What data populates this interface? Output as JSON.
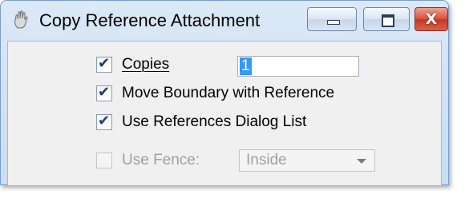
{
  "window": {
    "title": "Copy Reference Attachment",
    "icon": "hand-icon",
    "buttons": {
      "minimize": "minimize-icon",
      "maximize": "maximize-icon",
      "close": "close-icon",
      "close_glyph": "X"
    }
  },
  "form": {
    "copies": {
      "label": "Copies",
      "checked": true,
      "value": "1"
    },
    "move_boundary": {
      "label": "Move Boundary with Reference",
      "checked": true
    },
    "use_dialog_list": {
      "label": "Use References Dialog List",
      "checked": true
    },
    "use_fence": {
      "label": "Use Fence:",
      "checked": false,
      "enabled": false,
      "selected": "Inside"
    }
  },
  "colors": {
    "title_bar": "#dbe8f7",
    "close_button": "#c33a23",
    "selection": "#3399ff"
  }
}
